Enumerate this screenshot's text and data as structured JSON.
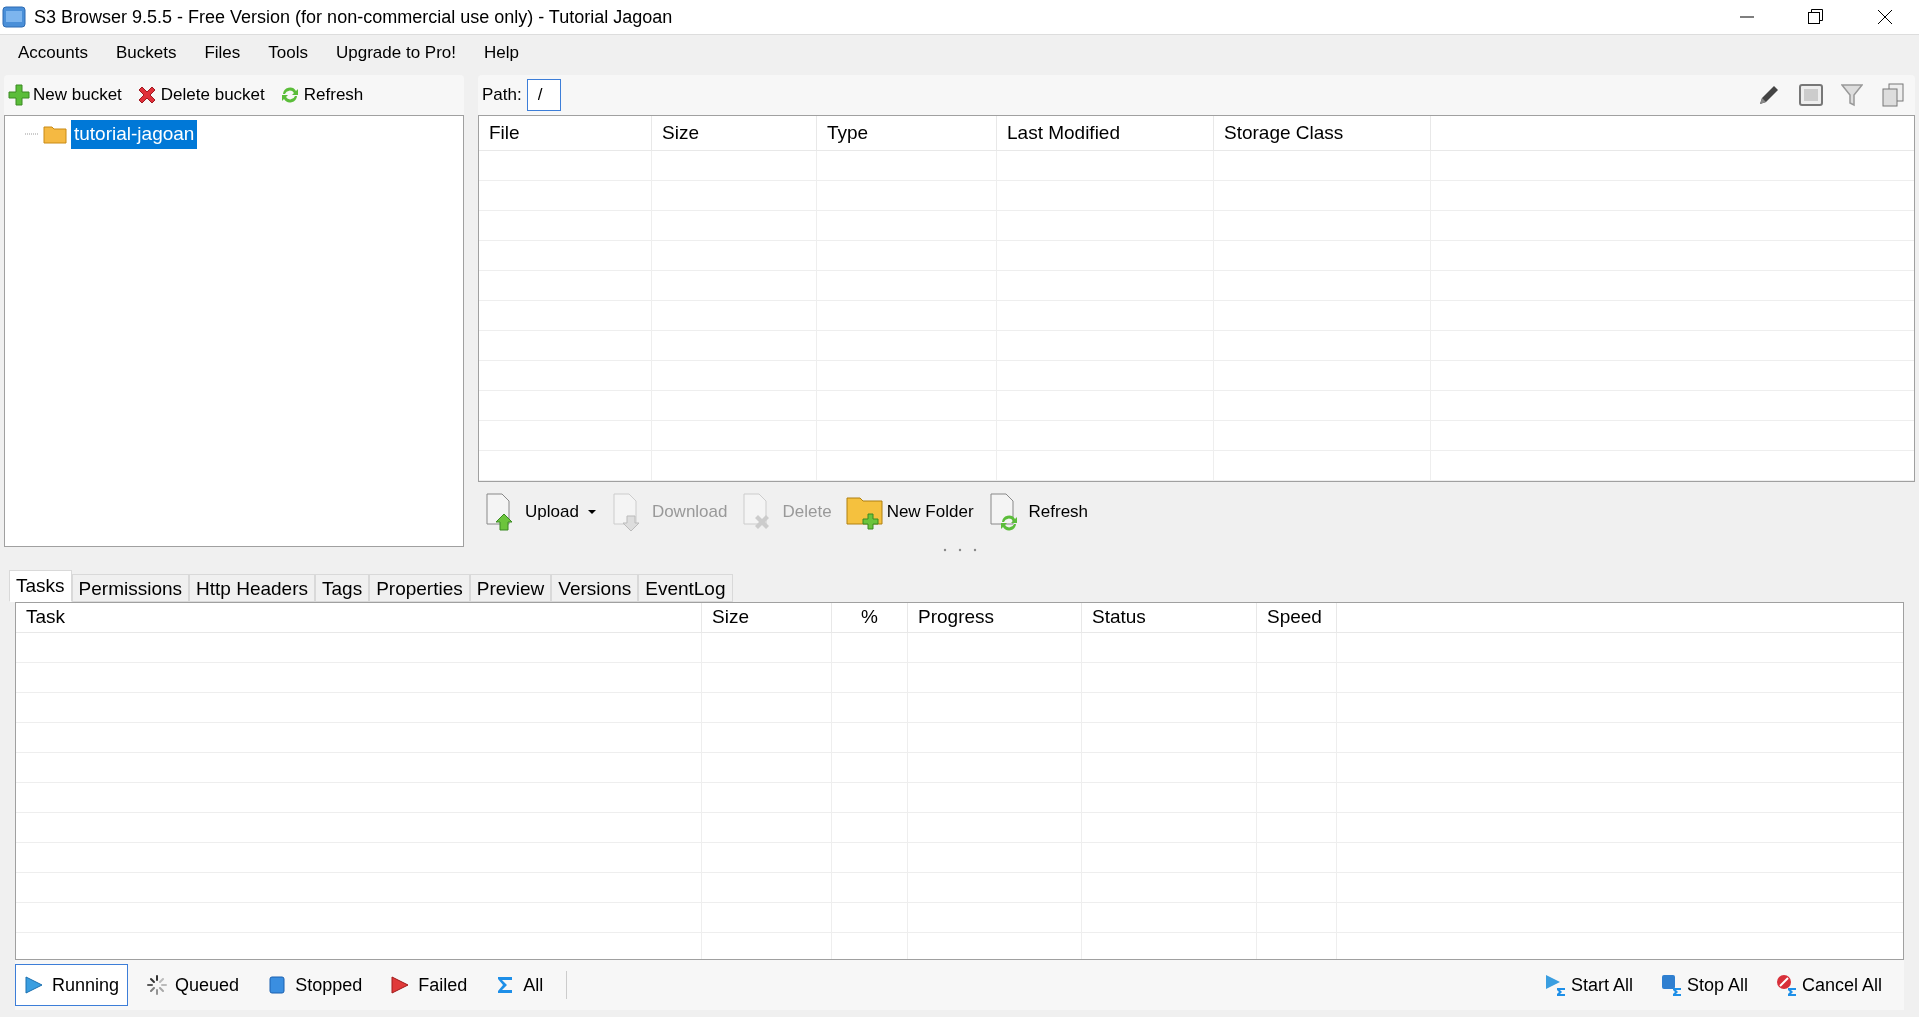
{
  "window": {
    "title": "S3 Browser 9.5.5 - Free Version (for non-commercial use only) - Tutorial Jagoan"
  },
  "menu": [
    "Accounts",
    "Buckets",
    "Files",
    "Tools",
    "Upgrade to Pro!",
    "Help"
  ],
  "bucket_toolbar": [
    {
      "label": "New bucket",
      "kind": "add"
    },
    {
      "label": "Delete bucket",
      "kind": "delete"
    },
    {
      "label": "Refresh",
      "kind": "refresh"
    }
  ],
  "tree": [
    {
      "label": "tutorial-jagoan",
      "selected": true
    }
  ],
  "path": {
    "label": "Path:",
    "value": "/"
  },
  "file_table": {
    "columns": [
      "File",
      "Size",
      "Type",
      "Last Modified",
      "Storage Class"
    ]
  },
  "file_actions": [
    {
      "label": "Upload",
      "kind": "upload",
      "disabled": false,
      "dropdown": true
    },
    {
      "label": "Download",
      "kind": "download",
      "disabled": true,
      "dropdown": false
    },
    {
      "label": "Delete",
      "kind": "delete",
      "disabled": true,
      "dropdown": false
    },
    {
      "label": "New Folder",
      "kind": "folder",
      "disabled": false,
      "dropdown": false
    },
    {
      "label": "Refresh",
      "kind": "refresh",
      "disabled": false,
      "dropdown": false
    }
  ],
  "tabs": [
    {
      "label": "Tasks",
      "selected": true
    },
    {
      "label": "Permissions",
      "selected": false
    },
    {
      "label": "Http Headers",
      "selected": false
    },
    {
      "label": "Tags",
      "selected": false
    },
    {
      "label": "Properties",
      "selected": false
    },
    {
      "label": "Preview",
      "selected": false
    },
    {
      "label": "Versions",
      "selected": false
    },
    {
      "label": "EventLog",
      "selected": false
    }
  ],
  "task_table": {
    "columns": [
      "Task",
      "Size",
      "%",
      "Progress",
      "Status",
      "Speed"
    ]
  },
  "task_filters": [
    {
      "label": "Running",
      "kind": "running",
      "selected": true
    },
    {
      "label": "Queued",
      "kind": "queued",
      "selected": false
    },
    {
      "label": "Stopped",
      "kind": "stopped",
      "selected": false
    },
    {
      "label": "Failed",
      "kind": "failed",
      "selected": false
    },
    {
      "label": "All",
      "kind": "all",
      "selected": false
    }
  ],
  "task_actions": [
    {
      "label": "Start All",
      "kind": "start"
    },
    {
      "label": "Stop All",
      "kind": "stop"
    },
    {
      "label": "Cancel All",
      "kind": "cancel"
    }
  ]
}
